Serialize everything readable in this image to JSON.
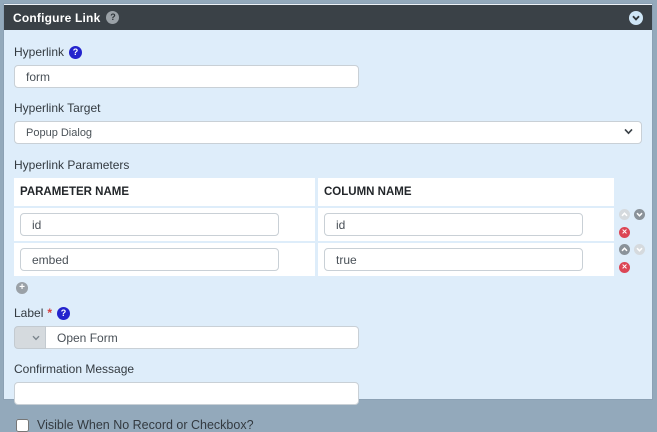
{
  "header": {
    "title": "Configure Link",
    "help_icon": "?",
    "collapse_icon": "chevron-down"
  },
  "hyperlink": {
    "label": "Hyperlink",
    "help_icon": "?",
    "value": "form"
  },
  "hyperlink_target": {
    "label": "Hyperlink Target",
    "value": "Popup Dialog"
  },
  "hyperlink_parameters": {
    "label": "Hyperlink Parameters",
    "columns": {
      "parameter": "PARAMETER NAME",
      "column": "COLUMN NAME"
    },
    "rows": [
      {
        "parameter_name": "id",
        "column_name": "id"
      },
      {
        "parameter_name": "embed",
        "column_name": "true"
      }
    ],
    "add_icon_label": "+",
    "delete_icon_label": "✕"
  },
  "label_field": {
    "label": "Label",
    "required_marker": "*",
    "help_icon": "?",
    "value": "Open Form"
  },
  "confirmation_message": {
    "label": "Confirmation Message",
    "value": ""
  },
  "visible_option": {
    "label": "Visible When No Record or Checkbox?",
    "checked": false
  },
  "colors": {
    "outer_bg": "#93a9bb",
    "header_bg": "#3a4147",
    "body_bg": "#deedfa",
    "help_icon_blue": "#2323cd",
    "delete_icon_red": "#dc4655",
    "arrow_enabled": "#8a9299",
    "arrow_disabled": "#d5dade"
  }
}
